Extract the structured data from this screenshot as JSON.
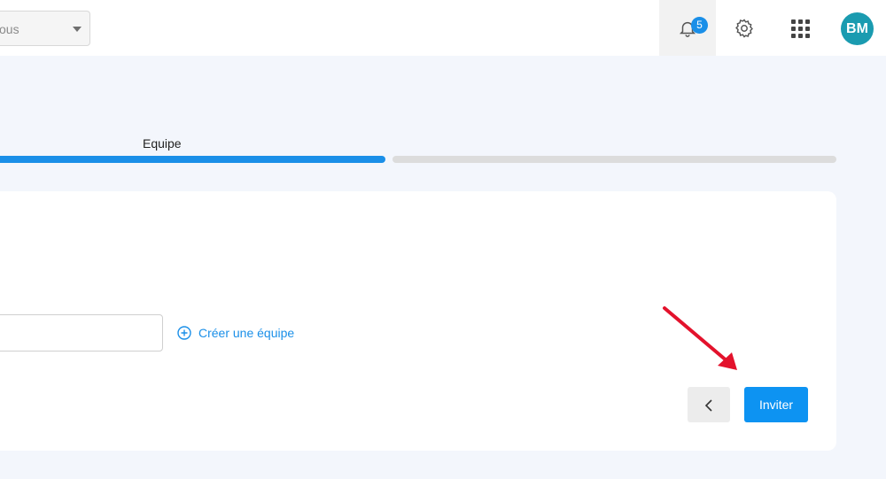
{
  "header": {
    "scope_select": {
      "value": "ous"
    },
    "notifications": {
      "icon": "bell-icon",
      "count": "5"
    },
    "settings": {
      "icon": "gear-icon"
    },
    "apps": {
      "icon": "grid-icon"
    },
    "avatar": {
      "initials": "BM",
      "color": "#1a9bb0"
    }
  },
  "stepper": {
    "current_step_label": "Equipe",
    "progress": 0.5,
    "accent_color": "#1a8fe8"
  },
  "form": {
    "team_input": {
      "value": "",
      "placeholder": ""
    },
    "create_team": {
      "icon": "plus-circle-icon",
      "label": "Créer une équipe"
    }
  },
  "actions": {
    "back": {
      "icon": "chevron-left-icon"
    },
    "invite_label": "Inviter"
  },
  "annotation": {
    "icon": "red-arrow-icon",
    "color": "#e3122c"
  }
}
